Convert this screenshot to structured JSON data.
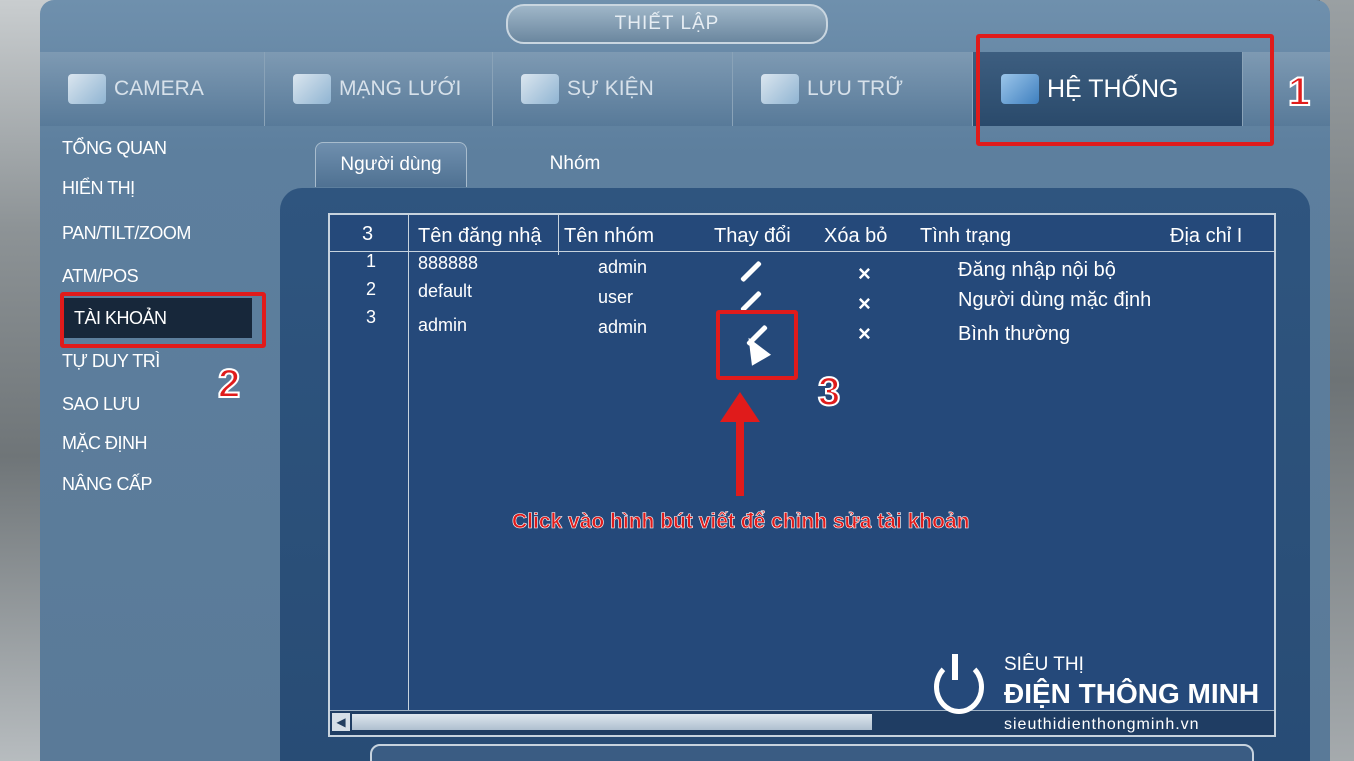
{
  "window": {
    "title": "THIẾT LẬP"
  },
  "top_tabs": [
    {
      "label": "CAMERA",
      "icon": "camera-icon"
    },
    {
      "label": "MẠNG LƯỚI",
      "icon": "network-icon"
    },
    {
      "label": "SỰ KIỆN",
      "icon": "event-icon"
    },
    {
      "label": "LƯU TRỮ",
      "icon": "storage-icon"
    },
    {
      "label": "HỆ THỐNG",
      "icon": "system-icon",
      "active": true
    }
  ],
  "sidebar": {
    "items": [
      {
        "label": "TỔNG QUAN"
      },
      {
        "label": "HIỂN THỊ"
      },
      {
        "label": "PAN/TILT/ZOOM"
      },
      {
        "label": "ATM/POS"
      },
      {
        "label": "TÀI KHOẢN",
        "active": true
      },
      {
        "label": "TỰ DUY TRÌ"
      },
      {
        "label": "SAO LƯU"
      },
      {
        "label": "MẶC ĐỊNH"
      },
      {
        "label": "NÂNG CẤP"
      }
    ]
  },
  "sub_tabs": [
    {
      "label": "Người dùng",
      "active": true
    },
    {
      "label": "Nhóm"
    }
  ],
  "users_table": {
    "count": "3",
    "headers": [
      "Tên đăng nhậ",
      "Tên nhóm",
      "Thay đổi",
      "Xóa bỏ",
      "Tình trạng",
      "Địa chỉ I"
    ],
    "rows": [
      {
        "no": "1",
        "username": "888888",
        "group": "admin",
        "status": "Đăng nhập nội bộ"
      },
      {
        "no": "2",
        "username": "default",
        "group": "user",
        "status": "Người dùng mặc định"
      },
      {
        "no": "3",
        "username": "admin",
        "group": "admin",
        "status": "Bình thường"
      }
    ],
    "delete_symbol": "×"
  },
  "annotations": {
    "step1": "1",
    "step2": "2",
    "step3": "3",
    "instruction": "Click vào hình bút viết để chỉnh sửa tài khoản",
    "color": "#e01b1b"
  },
  "watermark": {
    "line1": "SIÊU THỊ",
    "line2": "ĐIỆN THÔNG MINH",
    "line3": "sieuthidienthongminh.vn"
  }
}
